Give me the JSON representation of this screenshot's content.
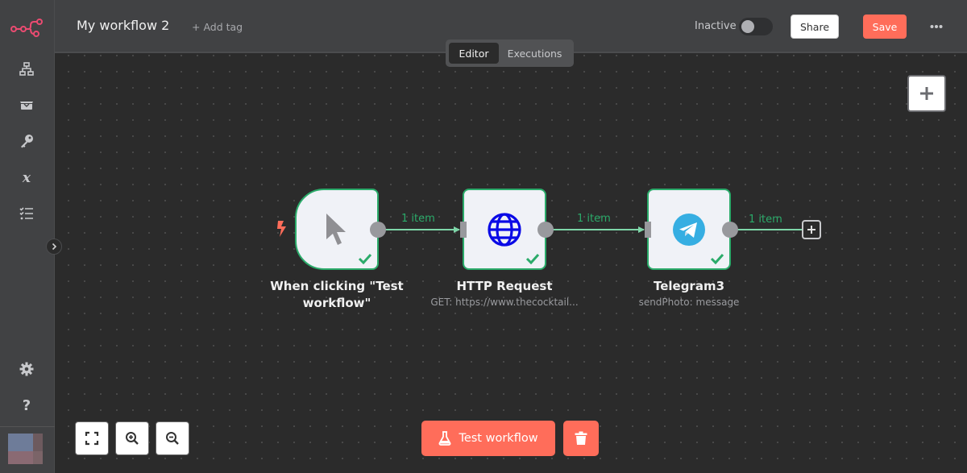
{
  "header": {
    "workflow_title": "My workflow 2",
    "add_tag_label": "+ Add tag",
    "status_label": "Inactive",
    "active": false,
    "share_label": "Share",
    "save_label": "Save",
    "more_label": "•••"
  },
  "tabs": [
    {
      "label": "Editor",
      "active": true
    },
    {
      "label": "Executions",
      "active": false
    }
  ],
  "sidebar": {
    "logo": "n8n-logo",
    "items": [
      {
        "icon": "workflows-icon",
        "label": "Workflows"
      },
      {
        "icon": "templates-icon",
        "label": "Templates"
      },
      {
        "icon": "credentials-icon",
        "label": "Credentials"
      },
      {
        "icon": "variables-icon",
        "label": "Variables"
      },
      {
        "icon": "executions-icon",
        "label": "All executions"
      }
    ],
    "bottom_items": [
      {
        "icon": "settings-icon",
        "label": "Settings"
      },
      {
        "icon": "help-icon",
        "label": "Help"
      }
    ]
  },
  "nodes": [
    {
      "id": "trigger",
      "title": "When clicking \"Test workflow\"",
      "subtitle": "",
      "icon": "cursor-icon",
      "status": "success"
    },
    {
      "id": "http",
      "title": "HTTP Request",
      "subtitle": "GET: https://www.thecocktail...",
      "icon": "globe-icon",
      "status": "success"
    },
    {
      "id": "telegram",
      "title": "Telegram3",
      "subtitle": "sendPhoto: message",
      "icon": "telegram-icon",
      "status": "success"
    }
  ],
  "edges": [
    {
      "from": "trigger",
      "to": "http",
      "label": "1 item"
    },
    {
      "from": "http",
      "to": "telegram",
      "label": "1 item"
    },
    {
      "from": "telegram",
      "to": "add",
      "label": "1 item"
    }
  ],
  "canvas_controls": {
    "fit_view": "fit-view-icon",
    "zoom_in": "zoom-in-icon",
    "zoom_out": "zoom-out-icon"
  },
  "actions": {
    "test_workflow_label": "Test workflow",
    "delete_label": "Delete"
  },
  "colors": {
    "accent": "#ff6d5a",
    "success": "#2bab6a",
    "edge": "#7ed6a8",
    "canvas": "#2b2b2b",
    "chrome": "#414244"
  }
}
